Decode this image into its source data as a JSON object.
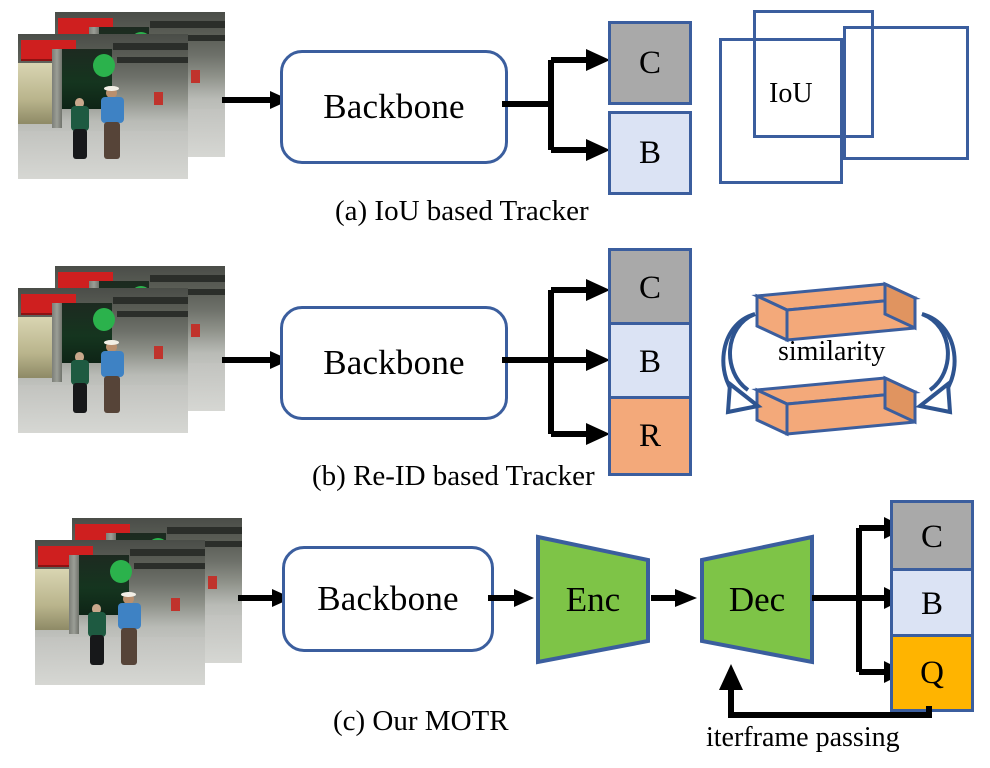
{
  "figure": {
    "title": "MOTR comparison diagram",
    "rows": [
      {
        "id": "row-a",
        "caption": "(a) IoU based Tracker",
        "backbone_label": "Backbone",
        "outputs": [
          {
            "key": "C",
            "label": "C",
            "color": "#a9a9a9"
          },
          {
            "key": "B",
            "label": "B",
            "color": "#dbe3f4"
          }
        ],
        "right_panel": {
          "type": "iou",
          "label": "IoU",
          "box_count": 3
        }
      },
      {
        "id": "row-b",
        "caption": "(b) Re-ID based Tracker",
        "backbone_label": "Backbone",
        "outputs": [
          {
            "key": "C",
            "label": "C",
            "color": "#a9a9a9"
          },
          {
            "key": "B",
            "label": "B",
            "color": "#dbe3f4"
          },
          {
            "key": "R",
            "label": "R",
            "color": "#f3a97a"
          }
        ],
        "right_panel": {
          "type": "similarity",
          "label": "similarity",
          "bar_count": 2
        }
      },
      {
        "id": "row-c",
        "caption": "(c) Our MOTR",
        "backbone_label": "Backbone",
        "encoder_label": "Enc",
        "decoder_label": "Dec",
        "feedback_label": "iterframe passing",
        "outputs": [
          {
            "key": "C",
            "label": "C",
            "color": "#a9a9a9"
          },
          {
            "key": "B",
            "label": "B",
            "color": "#dbe3f4"
          },
          {
            "key": "Q",
            "label": "Q",
            "color": "#ffb400"
          }
        ]
      }
    ]
  },
  "colors": {
    "outline_blue": "#3b5e9e",
    "gray_box": "#a9a9a9",
    "light_blue_box": "#dbe3f4",
    "salmon_box": "#f3a97a",
    "amber_box": "#ffb400",
    "green_trapezoid": "#7ec447",
    "arrow_black": "#000000",
    "background": "#ffffff"
  },
  "icons": {
    "arrow_right": "arrow-right-icon",
    "arrow_up": "arrow-up-icon",
    "curved_arrow": "curved-arrow-icon",
    "photo_stack": "photo-stack-icon"
  }
}
